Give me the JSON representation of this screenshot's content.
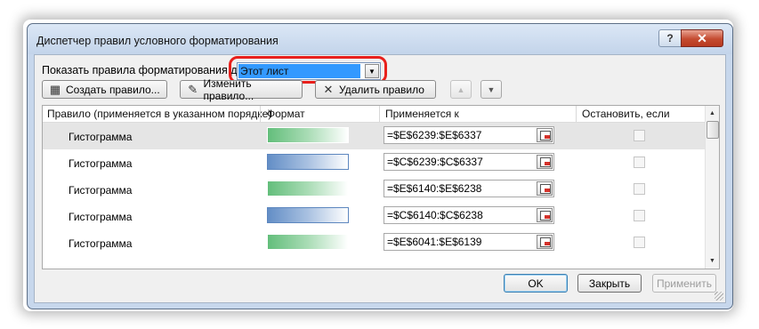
{
  "window": {
    "title": "Диспетчер правил условного форматирования",
    "help_label": "?",
    "close_label": "✕"
  },
  "scope": {
    "label": "Показать правила форматирования для:",
    "value": "Этот лист",
    "highlight_color": "#e8201c"
  },
  "toolbar": {
    "create_label": "Создать правило...",
    "edit_label": "Изменить правило...",
    "delete_label": "Удалить правило"
  },
  "columns": {
    "rule": "Правило (применяется в указанном порядке)",
    "format": "Формат",
    "applies_to": "Применяется к",
    "stop_if_true": "Остановить, если истина"
  },
  "rules": [
    {
      "name": "Гистограмма",
      "bar_color": "green",
      "range": "=$E$6239:$E$6337",
      "stop_if_true": false
    },
    {
      "name": "Гистограмма",
      "bar_color": "blue",
      "range": "=$C$6239:$C$6337",
      "stop_if_true": false
    },
    {
      "name": "Гистограмма",
      "bar_color": "green",
      "range": "=$E$6140:$E$6238",
      "stop_if_true": false
    },
    {
      "name": "Гистограмма",
      "bar_color": "blue",
      "range": "=$C$6140:$C$6238",
      "stop_if_true": false
    },
    {
      "name": "Гистограмма",
      "bar_color": "green",
      "range": "=$E$6041:$E$6139",
      "stop_if_true": false
    }
  ],
  "colors": {
    "green_bar": "#63be7b",
    "blue_bar": "#638ec6",
    "selected_row": "#e5e5e5"
  },
  "footer": {
    "ok_label": "OK",
    "close_label": "Закрыть",
    "apply_label": "Применить"
  }
}
